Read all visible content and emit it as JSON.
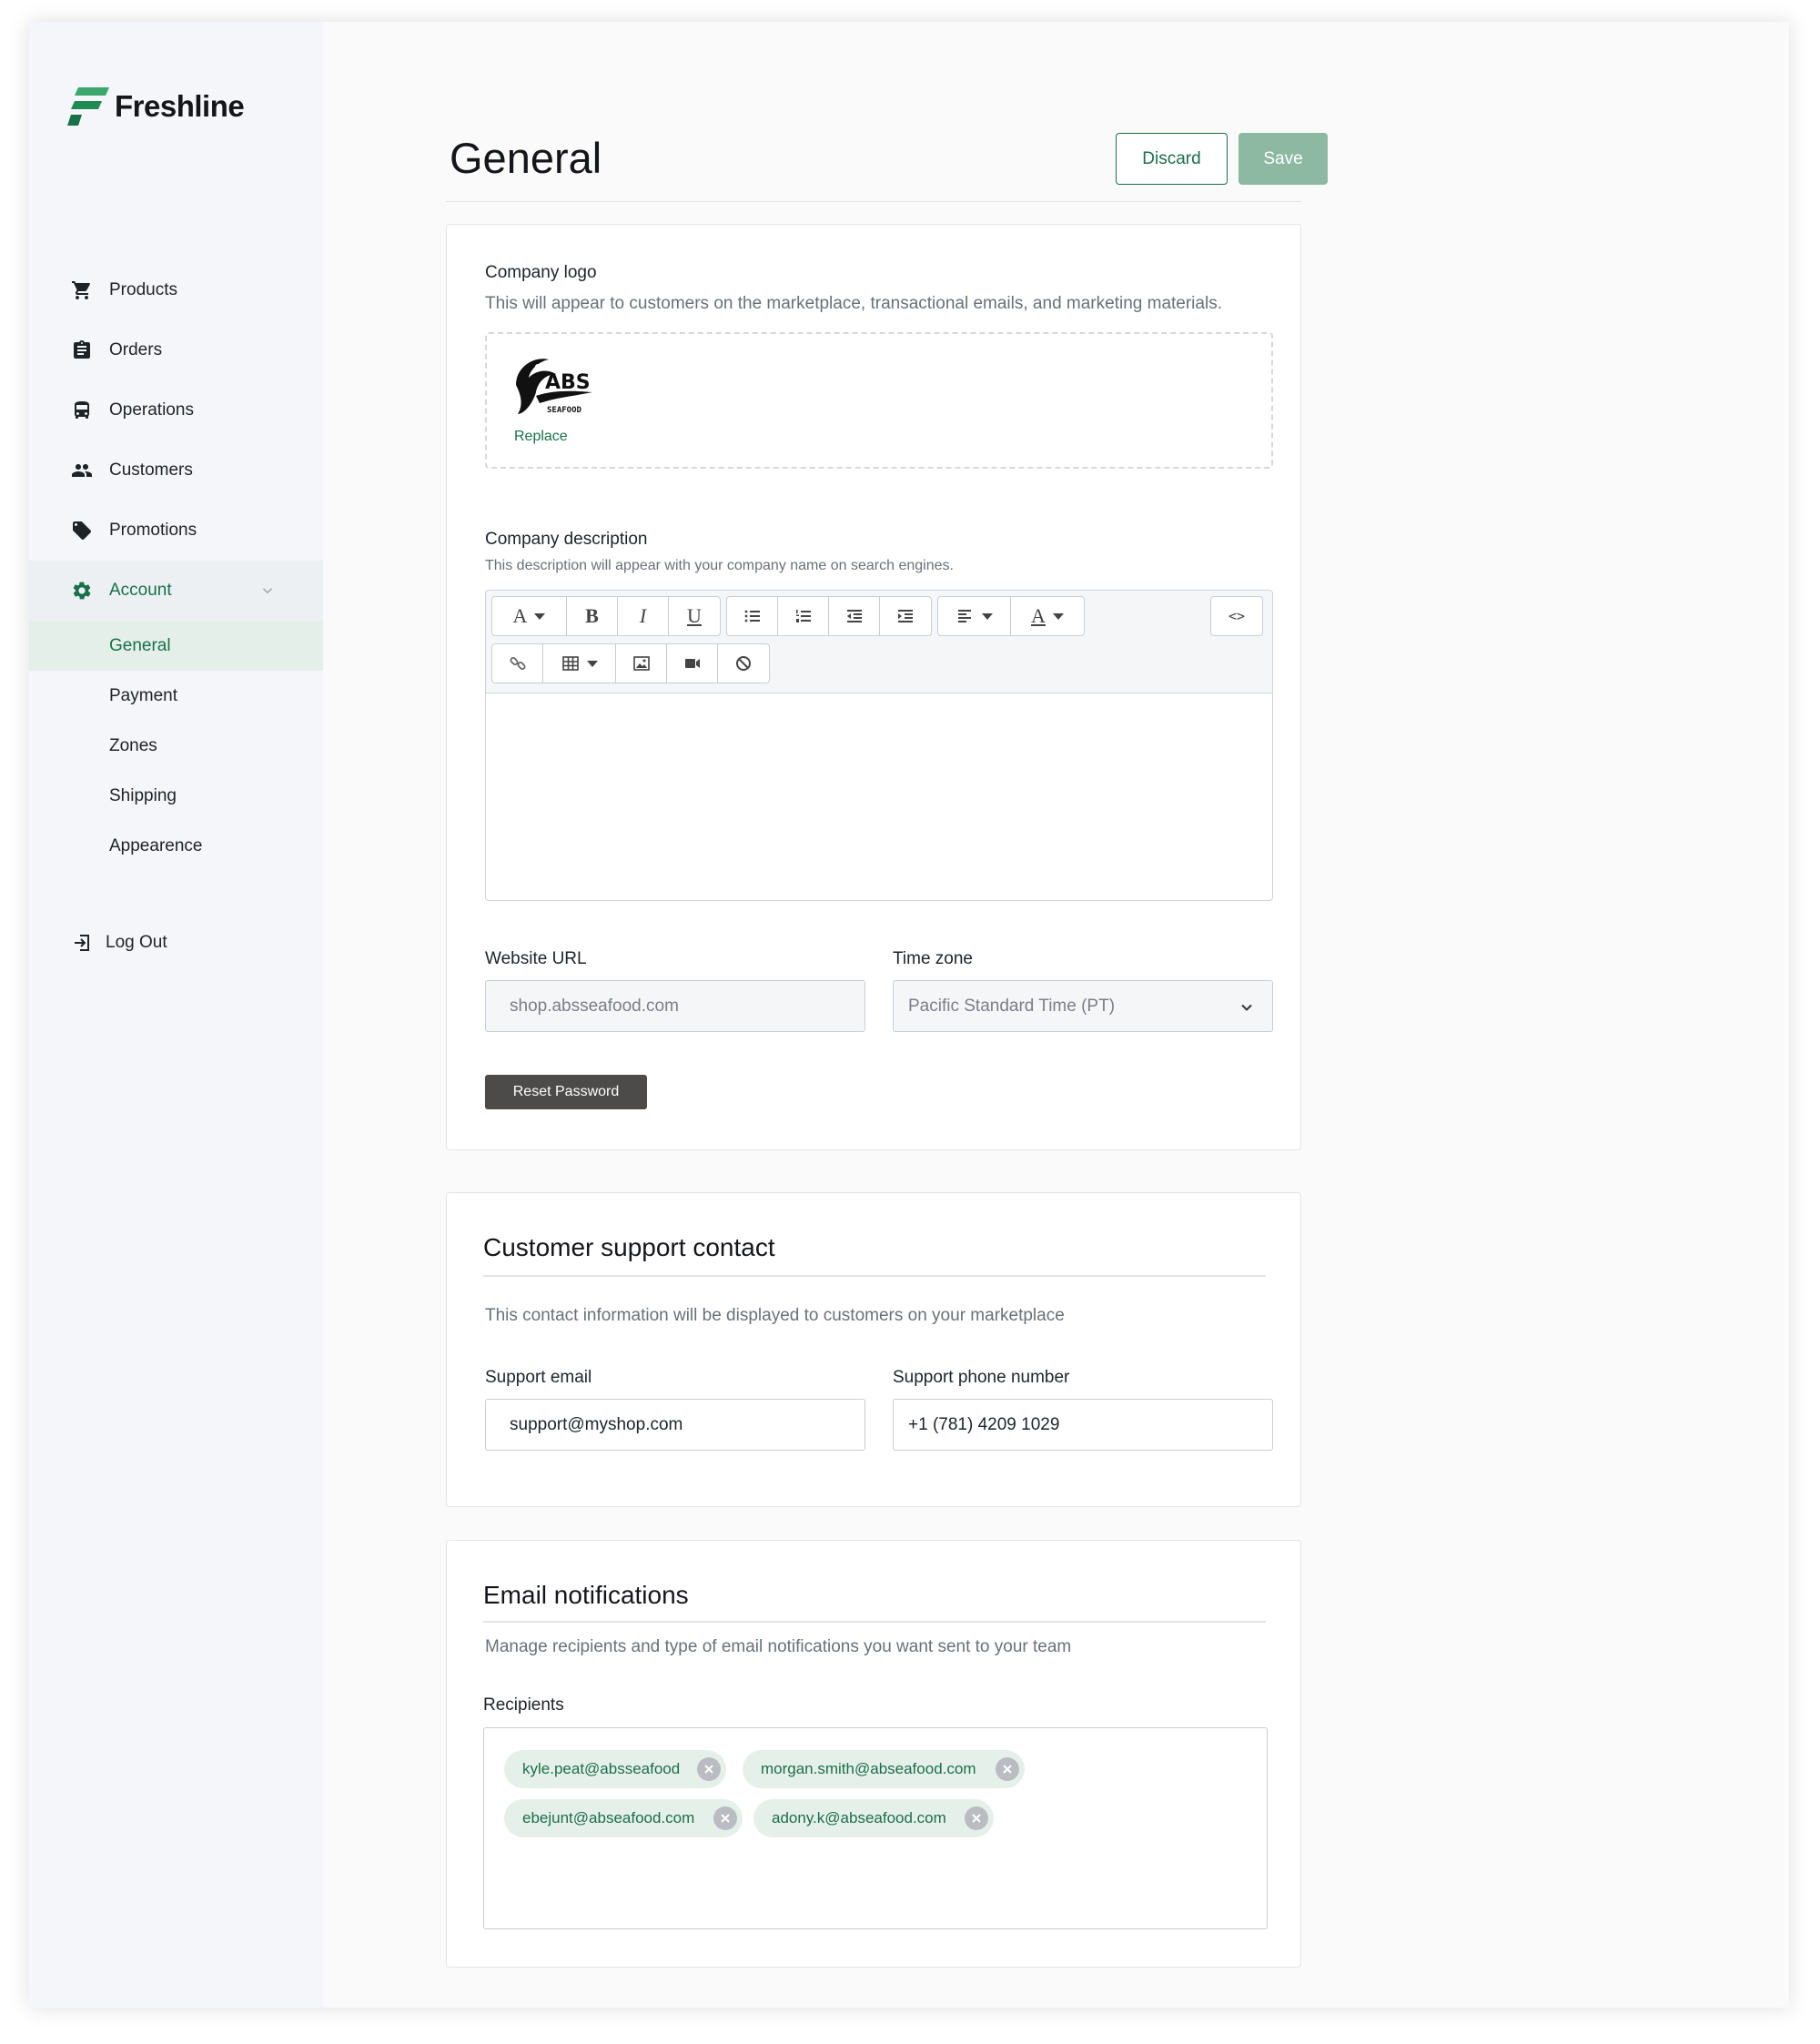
{
  "brand": {
    "name": "Freshline",
    "accent": "#17714a"
  },
  "sidebar": {
    "items": [
      {
        "label": "Products",
        "icon": "cart-icon"
      },
      {
        "label": "Orders",
        "icon": "clipboard-icon"
      },
      {
        "label": "Operations",
        "icon": "bus-icon"
      },
      {
        "label": "Customers",
        "icon": "people-icon"
      },
      {
        "label": "Promotions",
        "icon": "tag-icon"
      },
      {
        "label": "Account",
        "icon": "gear-icon",
        "expanded": true
      }
    ],
    "account_sub": [
      "General",
      "Payment",
      "Zones",
      "Shipping",
      "Appearence"
    ],
    "active_sub": "General",
    "logout": "Log Out"
  },
  "header": {
    "title": "General",
    "discard": "Discard",
    "save": "Save"
  },
  "company_logo": {
    "label": "Company logo",
    "help": "This will appear to customers on the marketplace, transactional emails, and marketing materials.",
    "replace": "Replace"
  },
  "company_description": {
    "label": "Company description",
    "help": "This description will appear with your company name on search engines.",
    "toolbar_icons": [
      "font-icon",
      "bold-icon",
      "italic-icon",
      "underline-icon",
      "bullet-list-icon",
      "numbered-list-icon",
      "outdent-icon",
      "indent-icon",
      "align-icon",
      "text-color-icon",
      "code-view-icon",
      "link-icon",
      "table-icon",
      "image-icon",
      "video-icon",
      "clear-format-icon"
    ]
  },
  "website": {
    "label": "Website URL",
    "value": "shop.absseafood.com"
  },
  "timezone": {
    "label": "Time zone",
    "value": "Pacific Standard Time (PT)"
  },
  "reset_password": "Reset Password",
  "support": {
    "title": "Customer support contact",
    "help": "This contact information will be displayed to customers on your marketplace",
    "email_label": "Support email",
    "email_value": "support@myshop.com",
    "phone_label": "Support phone number",
    "phone_value": "+1 (781) 4209 1029"
  },
  "notifications": {
    "title": "Email notifications",
    "help": "Manage recipients and type of email notifications you want sent to your team",
    "recipients_label": "Recipients",
    "recipients": [
      "kyle.peat@absseafood",
      "morgan.smith@abseafood.com",
      "ebejunt@abseafood.com",
      "adony.k@abseafood.com"
    ]
  }
}
